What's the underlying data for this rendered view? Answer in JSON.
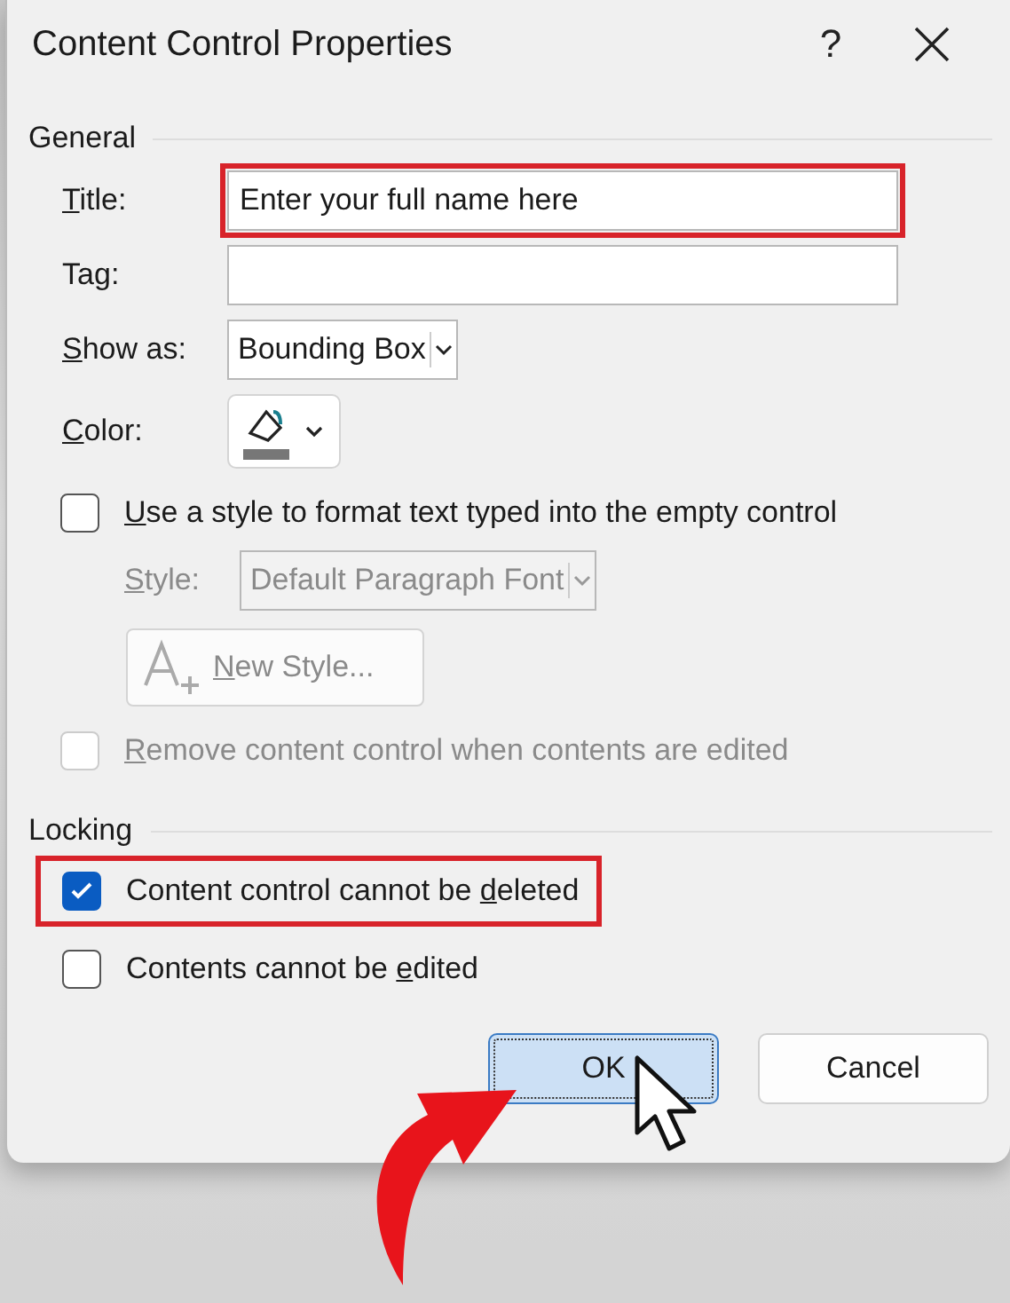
{
  "window": {
    "title": "Content Control Properties",
    "help": "?"
  },
  "general": {
    "heading": "General",
    "title": {
      "label": {
        "key": "T",
        "post": "itle:"
      },
      "value": "Enter your full name here",
      "highlighted": true
    },
    "tag": {
      "label": {
        "pre": "Ta",
        "key": "g",
        "post": ":"
      }
    },
    "show_as": {
      "label": {
        "key": "S",
        "post": "how as:"
      },
      "value": "Bounding Box"
    },
    "color": {
      "label": {
        "key": "C",
        "post": "olor:"
      }
    },
    "use_style": {
      "label": {
        "key": "U",
        "post": "se a style to format text typed into the empty control"
      },
      "checked": false,
      "disabled": false
    },
    "style": {
      "label": {
        "key": "S",
        "post": "tyle:"
      },
      "value": "Default Paragraph Font",
      "disabled": true
    },
    "new_style": {
      "label": {
        "key": "N",
        "post": "ew Style..."
      },
      "disabled": true
    },
    "remove": {
      "label": {
        "key": "R",
        "post": "emove content control when contents are edited"
      },
      "checked": false,
      "disabled": true
    }
  },
  "locking": {
    "heading": "Locking",
    "options": [
      {
        "label": {
          "pre": "Content control cannot be ",
          "key": "d",
          "post": "eleted"
        },
        "checked": true,
        "highlighted": true
      },
      {
        "label": {
          "pre": "Contents cannot be ",
          "key": "e",
          "post": "dited"
        },
        "checked": false,
        "highlighted": false
      }
    ]
  },
  "buttons": [
    {
      "label": "OK",
      "focused": true,
      "pointer_arrow": true,
      "mouse_cursor": true
    },
    {
      "label": "Cancel",
      "focused": false,
      "pointer_arrow": false,
      "mouse_cursor": false
    }
  ]
}
